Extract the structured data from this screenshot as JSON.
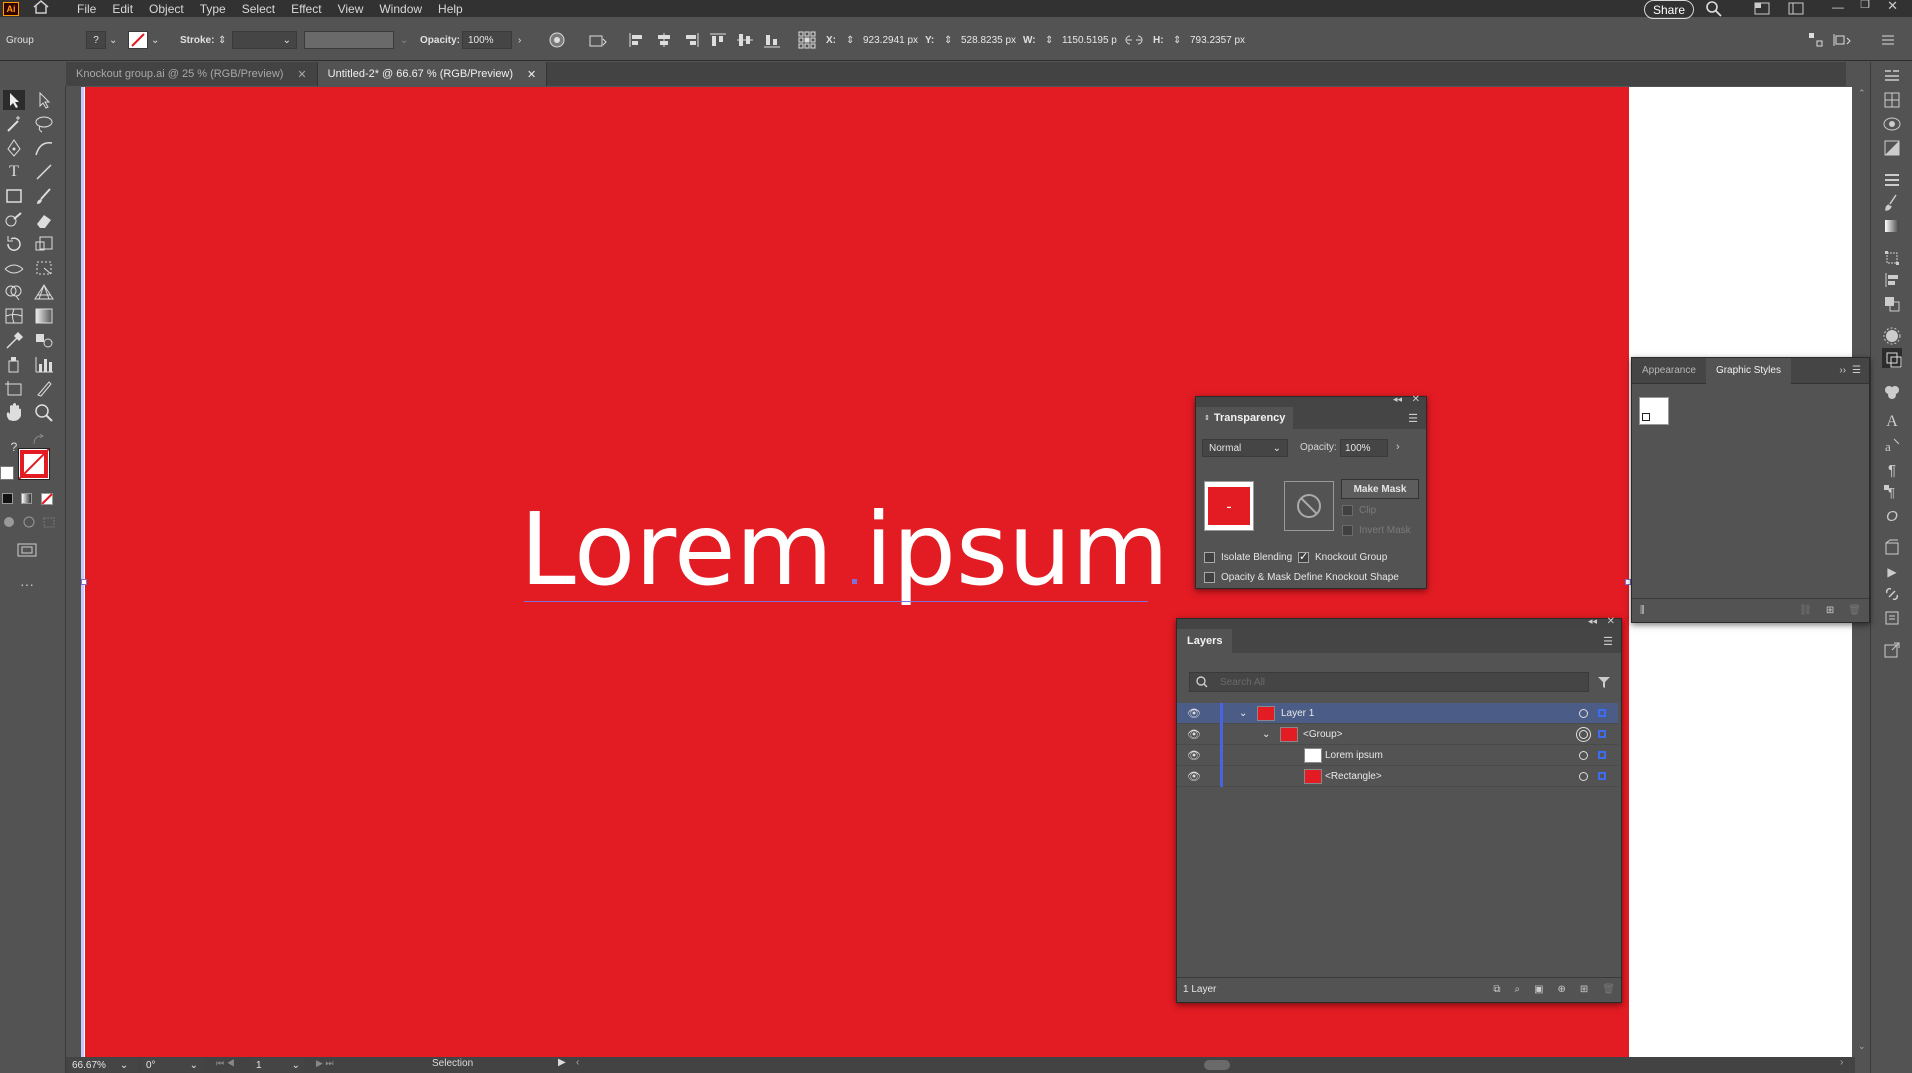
{
  "app": {
    "logo_text": "Ai"
  },
  "menu": [
    "File",
    "Edit",
    "Object",
    "Type",
    "Select",
    "Effect",
    "View",
    "Window",
    "Help"
  ],
  "share_label": "Share",
  "control": {
    "selection_type": "Group",
    "stroke_label": "Stroke:",
    "opacity_label": "Opacity:",
    "opacity_value": "100%",
    "x_label": "X:",
    "x_value": "923.2941 px",
    "y_label": "Y:",
    "y_value": "528.8235 px",
    "w_label": "W:",
    "w_value": "1150.5195 p",
    "h_label": "H:",
    "h_value": "793.2357 px"
  },
  "tabs": [
    {
      "label": "Knockout group.ai @ 25 % (RGB/Preview)",
      "active": false
    },
    {
      "label": "Untitled-2* @ 66.67 % (RGB/Preview)",
      "active": true
    }
  ],
  "canvas": {
    "text": "Lorem ipsum",
    "rect_color": "#e31b23"
  },
  "appearance_panel": {
    "tabs": [
      "Appearance",
      "Graphic Styles"
    ]
  },
  "transparency": {
    "title": "Transparency",
    "blend_mode": "Normal",
    "opacity_label": "Opacity:",
    "opacity_value": "100%",
    "make_mask": "Make Mask",
    "clip": "Clip",
    "invert_mask": "Invert Mask",
    "isolate_blending": "Isolate Blending",
    "isolate_checked": false,
    "knockout_group": "Knockout Group",
    "knockout_checked": true,
    "opacity_mask_define": "Opacity & Mask Define Knockout Shape",
    "opacity_mask_checked": false
  },
  "layers": {
    "title": "Layers",
    "search_placeholder": "Search All",
    "rows": [
      {
        "name": "Layer 1"
      },
      {
        "name": "<Group>"
      },
      {
        "name": "Lorem ipsum"
      },
      {
        "name": "<Rectangle>"
      }
    ],
    "footer": "1 Layer"
  },
  "status": {
    "zoom": "66.67%",
    "rotation": "0°",
    "artboard": "1",
    "tool": "Selection"
  }
}
